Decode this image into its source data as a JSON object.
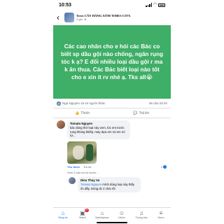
{
  "status_bar": {
    "time": "10:53"
  },
  "post": {
    "group_name": "Trees  CÂY HÀNG XÓM TIMES CITY.",
    "time_ago": "2 giờ",
    "privacy_icon": "globe-icon",
    "text": "Các cao nhân cho e hỏi các Bác co biết sp dầu gội nào chống, ngăn rụng tóc k ạ? E đổi nhiều loại dầu gội r ma k ăn thua. Các Bác biết loại nào tốt cho e xin ít rv nhé ạ. Tks all😭",
    "background_color": "#3fae66",
    "reactions_text": "Nga Nguyen và 44 người khác",
    "comments_count": "48 câu trả lời"
  },
  "actions": {
    "like": "Thích",
    "reply": "Trả lời"
  },
  "comments": [
    {
      "name": "Tomato Nguyen",
      "text": "bác dùng thử loại này xem,  tóc em trước rụng khủng khiếp, may dựa em nó em nó tự...",
      "like_label": "Yêu thích",
      "reply_label": "Trả lời",
      "count": "2"
    }
  ],
  "previous_replies": "Xem 2 câu trả lời trước...",
  "reply": {
    "name": "Dieu Thuy Vu",
    "mention": "Tomato Nguyen",
    "text": " mình dùng loại này thấy ổn đấy. Dùng đc 2 chai rồi"
  },
  "nav": [
    {
      "label": "Bảng tin",
      "icon": "home-icon",
      "active": true
    },
    {
      "label": "Watch",
      "icon": "video-icon",
      "badge": "9+"
    },
    {
      "label": "Marketplace",
      "icon": "store-icon"
    },
    {
      "label": "Nhóm",
      "icon": "groups-icon"
    },
    {
      "label": "Thông báo",
      "icon": "bell-icon"
    },
    {
      "label": "Menu",
      "icon": "menu-icon"
    }
  ],
  "colors": {
    "accent": "#1877f2",
    "banner": "#3fae66"
  }
}
